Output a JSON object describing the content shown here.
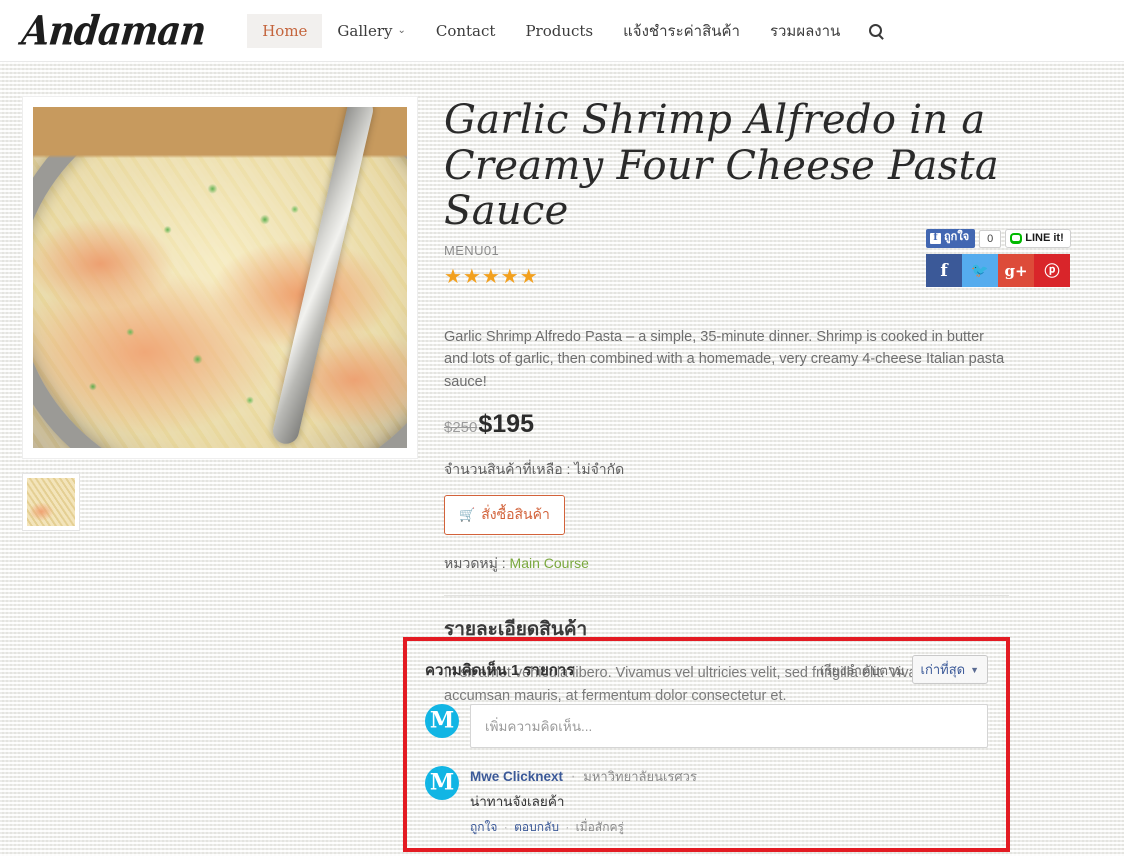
{
  "header": {
    "logo": "Andaman",
    "nav": [
      {
        "label": "Home",
        "active": true,
        "caret": ""
      },
      {
        "label": "Gallery",
        "active": false,
        "caret": "⌄"
      },
      {
        "label": "Contact",
        "active": false,
        "caret": ""
      },
      {
        "label": "Products",
        "active": false,
        "caret": ""
      },
      {
        "label": "แจ้งชำระค่าสินค้า",
        "active": false,
        "caret": ""
      },
      {
        "label": "รวมผลงาน",
        "active": false,
        "caret": ""
      }
    ],
    "search_icon": "search-icon"
  },
  "product": {
    "title": "Garlic Shrimp Alfredo in a Creamy Four Cheese Pasta Sauce",
    "sku": "MENU01",
    "stars": "★★★★★",
    "rating": 5,
    "description": "Garlic Shrimp Alfredo Pasta – a simple, 35-minute dinner. Shrimp is cooked in butter and lots of garlic, then combined with a homemade, very creamy 4-cheese Italian pasta sauce!",
    "price_old": "$250",
    "price_new": "$195",
    "stock": "จำนวนสินค้าที่เหลือ : ไม่จำกัด",
    "order_button": "สั่งซื้อสินค้า",
    "cart_icon": "🛒",
    "category_label": "หมวดหมู่ :",
    "category_value": "Main Course",
    "category_color": "#7aa83e"
  },
  "details_section": {
    "heading": "รายละเอียดสินค้า",
    "body": "In sit amet vehicula libero. Vivamus vel ultricies velit, sed fringilla elit. Vivamus porta accumsan mauris, at fermentum dolor consectetur et."
  },
  "social": {
    "fb_like_label": "ถูกใจ",
    "fb_like_icon": "f",
    "fb_count": "0",
    "line_label": "LINE it!",
    "share": [
      {
        "name": "facebook-share-button",
        "glyph": "f",
        "color": "#3b5998"
      },
      {
        "name": "twitter-share-button",
        "glyph": "🐦",
        "color": "#55acee"
      },
      {
        "name": "googleplus-share-button",
        "glyph": "g+",
        "color": "#dd4b39"
      },
      {
        "name": "pinterest-share-button",
        "glyph": "ⓟ",
        "color": "#d9252a"
      }
    ]
  },
  "comments": {
    "count_label": "ความคิดเห็น 1 รายการ",
    "sort_label": "เรียงลำดับตาม",
    "sort_value": "เก่าที่สุด",
    "input_placeholder": "เพิ่มความคิดเห็น...",
    "avatar_letter": "M",
    "items": [
      {
        "author": "Mwe Clicknext",
        "affiliation": "มหาวิทยาลัยนเรศวร",
        "text": "น่าทานจังเลยค้า",
        "like": "ถูกใจ",
        "reply": "ตอบกลับ",
        "time": "เมื่อสักครู่"
      }
    ],
    "highlight_color": "#e31b23"
  }
}
